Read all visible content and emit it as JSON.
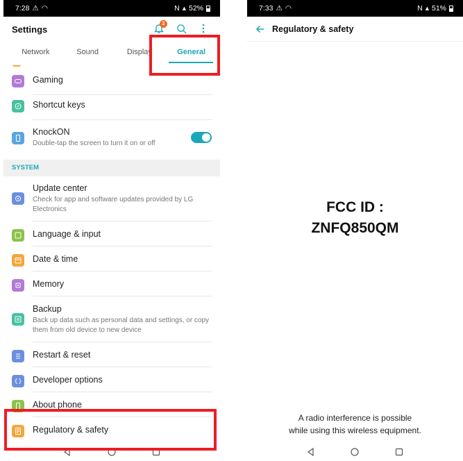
{
  "left": {
    "status": {
      "time": "7:28",
      "battery": "52%"
    },
    "title": "Settings",
    "notification_count": "2",
    "tabs": [
      {
        "label": "Network"
      },
      {
        "label": "Sound"
      },
      {
        "label": "Display"
      },
      {
        "label": "General"
      }
    ],
    "items_top": [
      {
        "title": "Gaming"
      },
      {
        "title": "Shortcut keys"
      },
      {
        "title": "KnockON",
        "subtitle": "Double-tap the screen to turn it on or off"
      }
    ],
    "section_system": "SYSTEM",
    "items_system": [
      {
        "title": "Update center",
        "subtitle": "Check for app and software updates provided by LG Electronics"
      },
      {
        "title": "Language & input"
      },
      {
        "title": "Date & time"
      },
      {
        "title": "Memory"
      },
      {
        "title": "Backup",
        "subtitle": "Back up data such as personal data and settings, or copy them from old device to new device"
      },
      {
        "title": "Restart & reset"
      },
      {
        "title": "Developer options"
      },
      {
        "title": "About phone"
      },
      {
        "title": "Regulatory & safety"
      }
    ]
  },
  "right": {
    "status": {
      "time": "7:33",
      "battery": "51%"
    },
    "title": "Regulatory & safety",
    "fcc_line1": "FCC ID :",
    "fcc_line2": "ZNFQ850QM",
    "notice_line1": "A radio interference is possible",
    "notice_line2": "while using this wireless equipment."
  },
  "colors": {
    "accent": "#1aa8b8",
    "highlight": "#ee1c24",
    "badge": "#f16a22"
  }
}
